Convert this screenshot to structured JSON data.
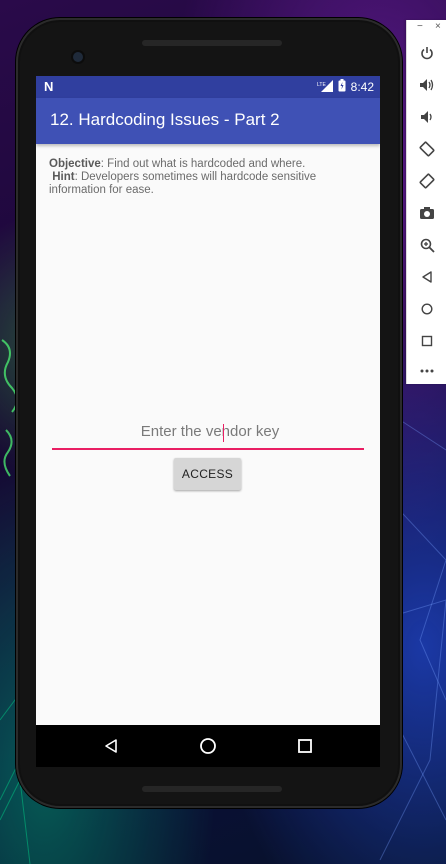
{
  "status_bar": {
    "notification_icon": "N",
    "network_label": "LTE",
    "time": "8:42"
  },
  "app_bar": {
    "title": "12. Hardcoding Issues - Part 2"
  },
  "content": {
    "objective_label": "Objective",
    "objective_text": ": Find out what is hardcoded and where.",
    "hint_label": "Hint",
    "hint_text": ": Developers sometimes will hardcode sensitive information for ease."
  },
  "vendor_key_input": {
    "value": "",
    "placeholder": "Enter the vendor key"
  },
  "access_button": {
    "label": "ACCESS"
  },
  "nav_bar": {
    "icons": [
      "back-icon",
      "home-icon",
      "recents-icon"
    ]
  },
  "emulator_toolbar": {
    "minimize": "−",
    "close": "×",
    "items": [
      "power-icon",
      "volume-up-icon",
      "volume-down-icon",
      "rotate-left-icon",
      "rotate-right-icon",
      "screenshot-icon",
      "zoom-icon",
      "back-icon",
      "home-icon",
      "overview-icon",
      "more-icon"
    ]
  },
  "colors": {
    "status_bar": "#303f9f",
    "app_bar": "#3f51b5",
    "accent": "#e91e63"
  }
}
